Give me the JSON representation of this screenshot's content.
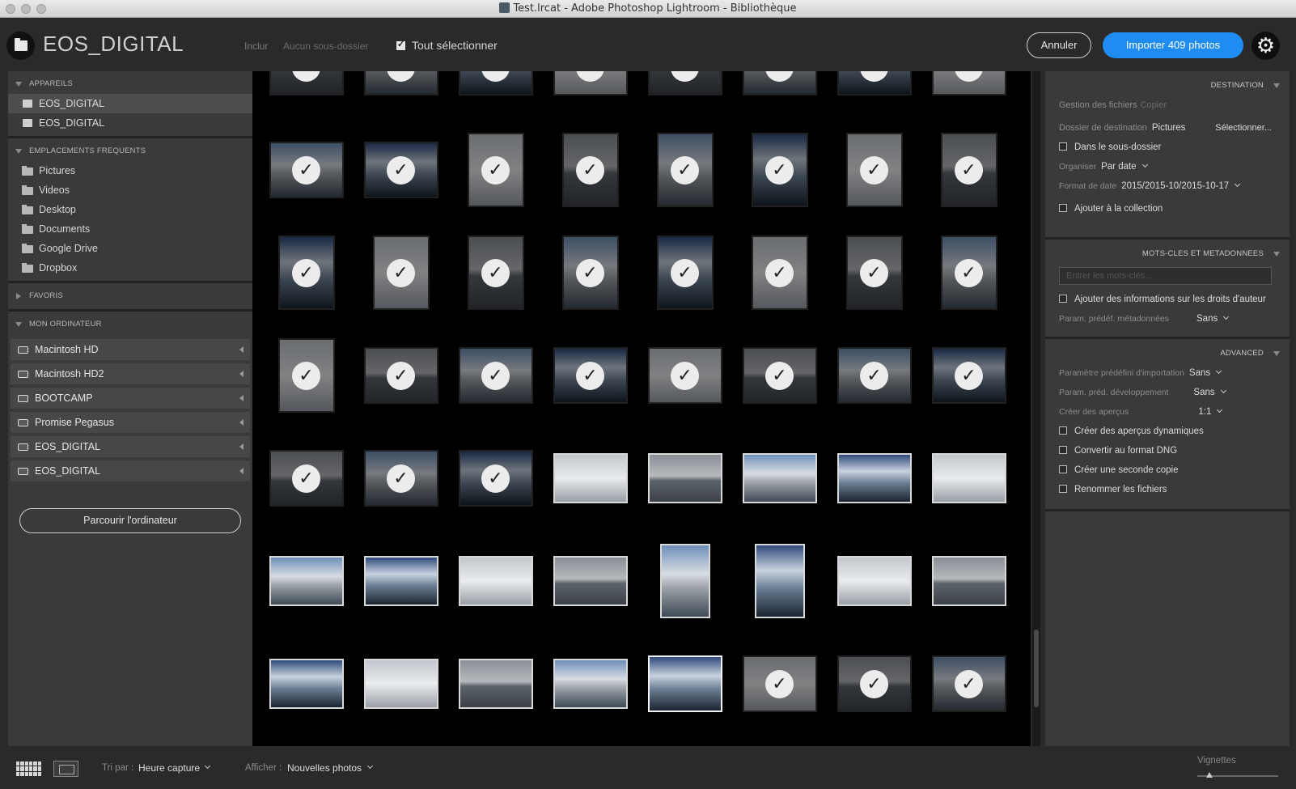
{
  "window": {
    "title": "Test.lrcat - Adobe Photoshop Lightroom - Bibliothèque"
  },
  "topbar": {
    "source_title": "EOS_DIGITAL",
    "include_label": "Inclur",
    "subfolder_label": "Aucun sous-dossier",
    "select_all_label": "Tout sélectionner",
    "select_all_checked": true,
    "cancel_label": "Annuler",
    "import_label": "Importer 409 photos",
    "import_color": "#1f8cf2"
  },
  "left_panel": {
    "devices_header": "APPAREILS",
    "devices": [
      {
        "label": "EOS_DIGITAL",
        "selected": true
      },
      {
        "label": "EOS_DIGITAL",
        "selected": false
      }
    ],
    "frequent_header": "EMPLACEMENTS FREQUENTS",
    "frequent": [
      "Pictures",
      "Videos",
      "Desktop",
      "Documents",
      "Google Drive",
      "Dropbox"
    ],
    "favorites_header": "FAVORIS",
    "computer_header": "MON ORDINATEUR",
    "volumes": [
      "Macintosh HD",
      "Macintosh HD2",
      "BOOTCAMP",
      "Promise Pegasus",
      "EOS_DIGITAL",
      "EOS_DIGITAL"
    ],
    "browse_label": "Parcourir l'ordinateur"
  },
  "grid": {
    "columns": 8,
    "rows": [
      [
        "checked-partial",
        "checked-partial",
        "checked-partial",
        "checked-partial",
        "checked-partial",
        "checked-partial",
        "checked-partial",
        "checked-partial"
      ],
      [
        "checked",
        "checked",
        "checked",
        "checked",
        "checked",
        "checked",
        "checked",
        "checked"
      ],
      [
        "checked",
        "checked",
        "checked",
        "checked",
        "checked",
        "checked",
        "checked",
        "checked"
      ],
      [
        "checked",
        "checked",
        "checked",
        "checked",
        "checked",
        "checked",
        "checked",
        "checked"
      ],
      [
        "checked",
        "checked",
        "checked",
        "unchecked",
        "unchecked",
        "unchecked",
        "unchecked",
        "unchecked"
      ],
      [
        "unchecked",
        "unchecked",
        "unchecked",
        "unchecked",
        "unchecked",
        "unchecked",
        "unchecked",
        "unchecked"
      ],
      [
        "unchecked",
        "unchecked",
        "unchecked",
        "unchecked",
        "selected",
        "checked",
        "checked",
        "checked"
      ]
    ],
    "orientations": [
      [
        "L",
        "L",
        "L",
        "L",
        "L",
        "L",
        "L",
        "L"
      ],
      [
        "L",
        "L",
        "P",
        "P",
        "P",
        "P",
        "P",
        "P"
      ],
      [
        "P",
        "P",
        "P",
        "P",
        "P",
        "P",
        "P",
        "P"
      ],
      [
        "P",
        "L",
        "L",
        "L",
        "L",
        "L",
        "L",
        "L"
      ],
      [
        "L",
        "L",
        "L",
        "L",
        "L",
        "L",
        "L",
        "L"
      ],
      [
        "L",
        "L",
        "L",
        "L",
        "P",
        "P",
        "L",
        "L"
      ],
      [
        "L",
        "L",
        "L",
        "L",
        "L",
        "L",
        "L",
        "L"
      ]
    ]
  },
  "right_panel": {
    "destination_header": "DESTINATION",
    "file_handling_label": "Gestion des fichiers",
    "file_handling_value": "Copier",
    "dest_folder_label": "Dossier de destination",
    "dest_folder_value": "Pictures",
    "dest_folder_action": "Sélectionner...",
    "subfolder_label": "Dans le sous-dossier",
    "organize_label": "Organiser",
    "organize_value": "Par date",
    "date_format_label": "Format de date",
    "date_format_value": "2015/2015-10/2015-10-17",
    "add_collection_label": "Ajouter à la collection",
    "keywords_header": "MOTS-CLES ET METADONNEES",
    "keywords_placeholder": "Entrer les mots-clés...",
    "copyright_label": "Ajouter des informations sur les droits d'auteur",
    "metadata_preset_label": "Param. prédéf. métadonnées",
    "metadata_preset_value": "Sans",
    "advanced_header": "ADVANCED",
    "import_preset_label": "Paramètre prédéfini d'importation",
    "import_preset_value": "Sans",
    "develop_preset_label": "Param. préd. développement",
    "develop_preset_value": "Sans",
    "previews_label": "Créer des aperçus",
    "previews_value": "1:1",
    "smart_previews_label": "Créer des aperçus dynamiques",
    "dng_label": "Convertir au format DNG",
    "second_copy_label": "Créer une seconde copie",
    "rename_label": "Renommer les fichiers"
  },
  "bottombar": {
    "sort_label": "Tri par :",
    "sort_value": "Heure capture",
    "show_label": "Afficher :",
    "show_value": "Nouvelles photos",
    "thumbnails_label": "Vignettes",
    "thumbnail_size": 0.15
  }
}
